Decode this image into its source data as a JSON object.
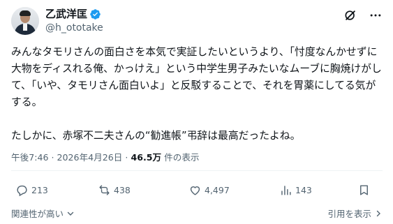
{
  "header": {
    "display_name": "乙武洋匡",
    "handle": "@h_ototake",
    "verified": true,
    "icons": [
      "grok-icon",
      "more-icon"
    ]
  },
  "tweet": {
    "text": "みんなタモリさんの面白さを本気で実証したいというより、「忖度なんかせずに大物をディスれる俺、かっけえ」という中学生男子みたいなムーブに胸焼けがして、「いや、タモリさん面白いよ」と反駁することで、それを胃薬にしてる気がする。\n\nたしかに、赤塚不二夫さんの“勧進帳”弔辞は最高だったよね。"
  },
  "meta": {
    "time": "午後7:46",
    "separator": "·",
    "date": "2026年4月26日",
    "views_count": "46.5万",
    "views_label": "件の表示"
  },
  "actions": {
    "reply_count": "213",
    "retweet_count": "438",
    "like_count": "4,497",
    "views_count": "143"
  },
  "footer": {
    "relevance_label": "関連性が高い",
    "quote_label": "引用を表示"
  },
  "colors": {
    "text": "#0f1419",
    "secondary": "#536471",
    "verified_blue": "#1d9bf0",
    "divider": "#eff3f4"
  }
}
